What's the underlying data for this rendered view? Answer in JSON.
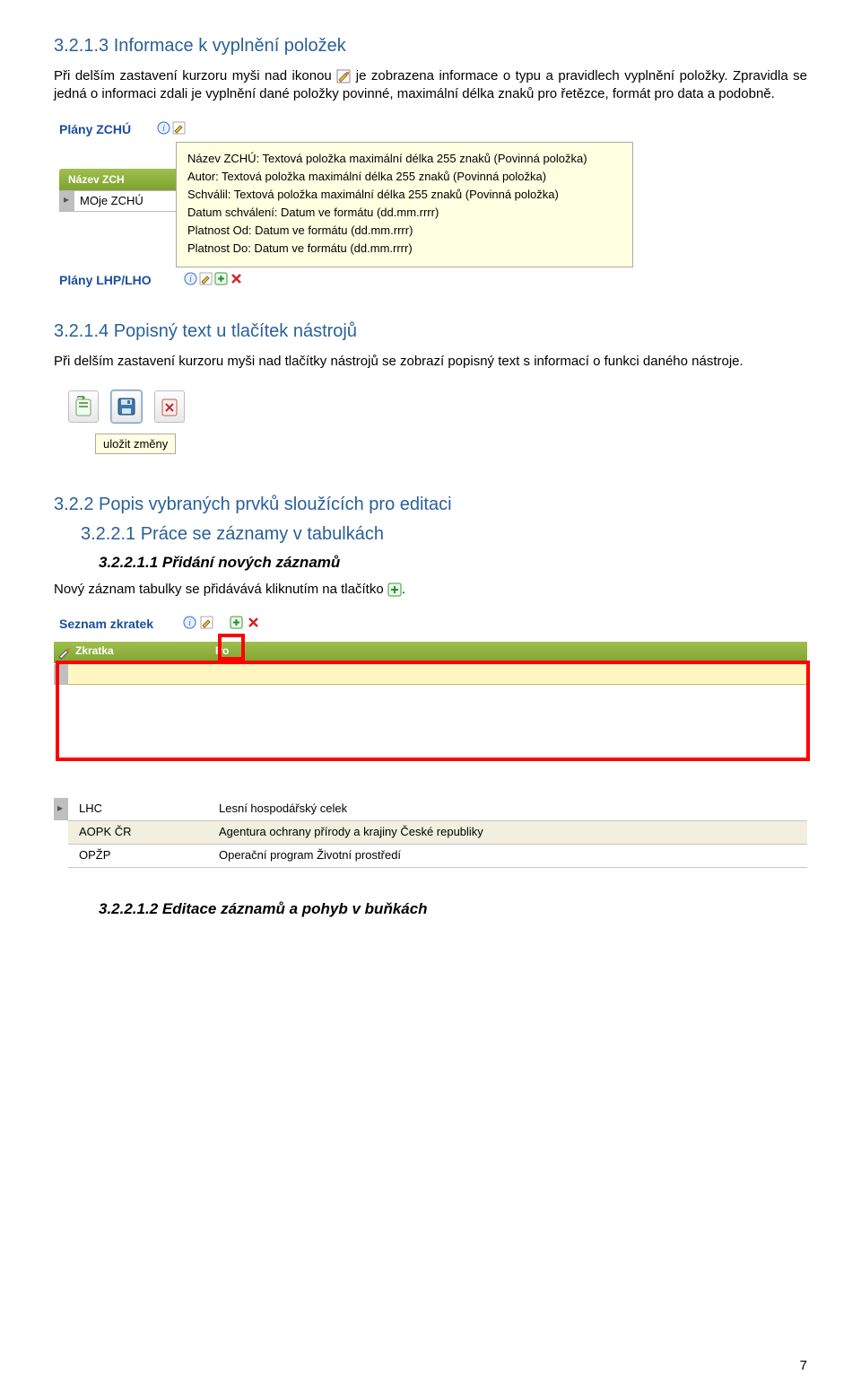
{
  "sec_3213": {
    "heading": "3.2.1.3 Informace k vyplnění položek",
    "para_before": "Při delším zastavení kurzoru myši nad ikonou",
    "para_after": " je zobrazena informace o typu a pravidlech vyplnění položky. Zpravidla se jedná o informaci zdali je vyplnění dané položky povinné, maximální délka znaků pro řetězce, formát pro data a podobně."
  },
  "shot1": {
    "title1": "Plány ZCHÚ",
    "title2": "Plány LHP/LHO",
    "green_header": "Název ZCH",
    "cell_value": "MOje ZCHÚ",
    "tooltip_lines": [
      "Název ZCHÚ: Textová položka maximální délka 255 znaků (Povinná položka)",
      "Autor: Textová položka maximální délka 255 znaků (Povinná položka)",
      "Schválil: Textová položka maximální délka 255 znaků (Povinná položka)",
      "Datum schválení: Datum ve formátu (dd.mm.rrrr)",
      "Platnost Od: Datum ve formátu (dd.mm.rrrr)",
      "Platnost Do: Datum ve formátu (dd.mm.rrrr)"
    ]
  },
  "sec_3214": {
    "heading": "3.2.1.4  Popisný text u tlačítek nástrojů",
    "para": "Při delším zastavení kurzoru myši nad tlačítky nástrojů se zobrazí popisný text s informací o funkci daného nástroje."
  },
  "shot2": {
    "tooltip": "uložit změny"
  },
  "sec_322": {
    "heading": "3.2.2   Popis vybraných prvků sloužících pro editaci"
  },
  "sec_3221": {
    "heading": "3.2.2.1 Práce se záznamy v tabulkách"
  },
  "sec_32211": {
    "heading": "3.2.2.1.1    Přidání  nových záznamů",
    "para_before": "Nový záznam tabulky se přidávává kliknutím na tlačítko ",
    "para_after": "."
  },
  "shot3": {
    "title": "Seznam zkratek",
    "col1": "Zkratka",
    "col2": "Po",
    "rows": [
      {
        "abbr": "LHC",
        "desc": "Lesní hospodářský celek"
      },
      {
        "abbr": "AOPK ČR",
        "desc": "Agentura ochrany přírody a krajiny České republiky"
      },
      {
        "abbr": "OPŽP",
        "desc": "Operační program Životní prostředí"
      }
    ]
  },
  "sec_32212": {
    "heading": "3.2.2.1.2    Editace záznamů a pohyb v buňkách"
  },
  "page_number": "7"
}
